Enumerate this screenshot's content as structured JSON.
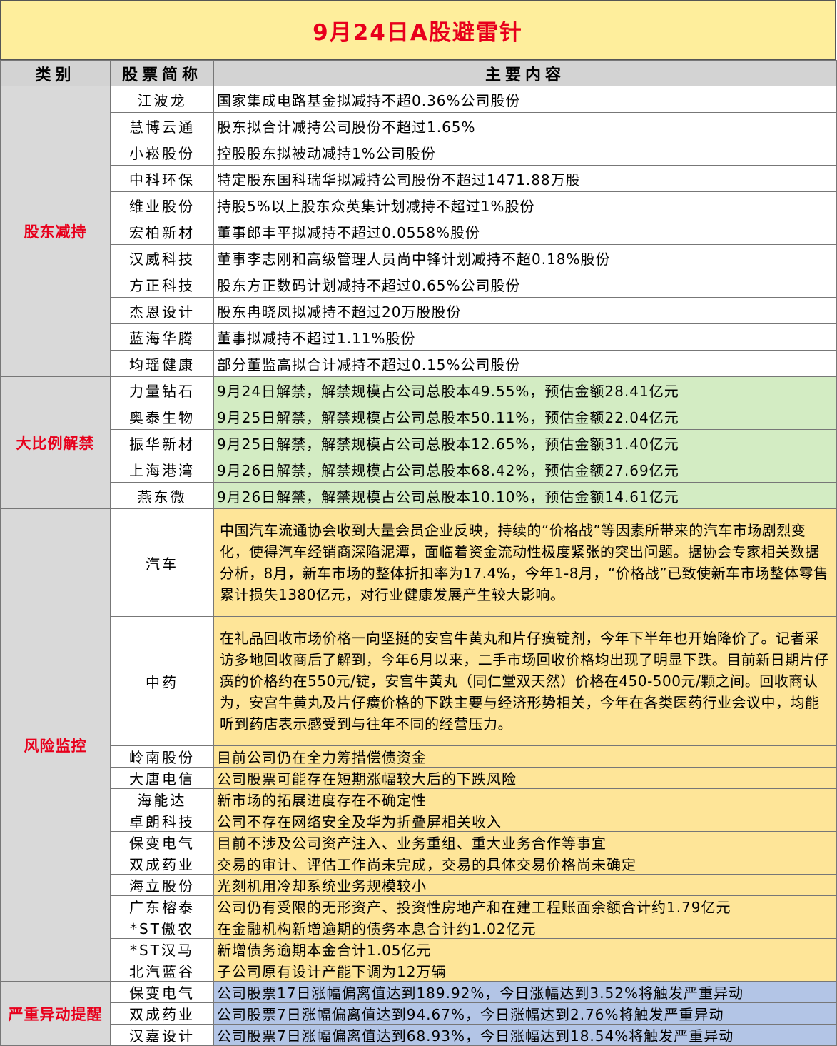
{
  "title": "9月24日A股避雷针",
  "headers": {
    "category": "类别",
    "stock": "股票简称",
    "content": "主要内容"
  },
  "sections": [
    {
      "category": "股东减持",
      "rows": [
        {
          "name": "江波龙",
          "content": "国家集成电路基金拟减持不超0.36%公司股份"
        },
        {
          "name": "慧博云通",
          "content": "股东拟合计减持公司股份不超过1.65%"
        },
        {
          "name": "小崧股份",
          "content": "控股股东拟被动减持1%公司股份"
        },
        {
          "name": "中科环保",
          "content": "特定股东国科瑞华拟减持公司股份不超过1471.88万股"
        },
        {
          "name": "维业股份",
          "content": "持股5%以上股东众英集计划减持不超过1%股份"
        },
        {
          "name": "宏柏新材",
          "content": "董事郎丰平拟减持不超过0.0558%股份"
        },
        {
          "name": "汉威科技",
          "content": "董事李志刚和高级管理人员尚中锋计划减持不超0.18%股份"
        },
        {
          "name": "方正科技",
          "content": "股东方正数码计划减持不超过0.65%公司股份"
        },
        {
          "name": "杰恩设计",
          "content": "股东冉晓凤拟减持不超过20万股股份"
        },
        {
          "name": "蓝海华腾",
          "content": "董事拟减持不超过1.11%股份"
        },
        {
          "name": "均瑶健康",
          "content": "部分董监高拟合计减持不超过0.15%公司股份"
        }
      ]
    },
    {
      "category": "大比例解禁",
      "rows": [
        {
          "name": "力量钻石",
          "content": "9月24日解禁，解禁规模占公司总股本49.55%，预估金额28.41亿元"
        },
        {
          "name": "奥泰生物",
          "content": "9月25日解禁，解禁规模占公司总股本50.11%，预估金额22.04亿元"
        },
        {
          "name": "振华新材",
          "content": "9月25日解禁，解禁规模占公司总股本12.65%，预估金额31.40亿元"
        },
        {
          "name": "上海港湾",
          "content": "9月26日解禁，解禁规模占公司总股本68.42%，预估金额27.69亿元"
        },
        {
          "name": "燕东微",
          "content": "9月26日解禁，解禁规模占公司总股本10.10%，预估金额14.61亿元"
        }
      ]
    },
    {
      "category": "风险监控",
      "long_rows": [
        {
          "name": "汽车",
          "content": "中国汽车流通协会收到大量会员企业反映，持续的“价格战”等因素所带来的汽车市场剧烈变化，使得汽车经销商深陷泥潭，面临着资金流动性极度紧张的突出问题。据协会专家相关数据分析，8月，新车市场的整体折扣率为17.4%，今年1-8月，“价格战”已致使新车市场整体零售累计损失1380亿元，对行业健康发展产生较大影响。"
        },
        {
          "name": "中药",
          "content": "在礼品回收市场价格一向坚挺的安宫牛黄丸和片仔癀锭剂，今年下半年也开始降价了。记者采访多地回收商后了解到，今年6月以来，二手市场回收价格均出现了明显下跌。目前新日期片仔癀的价格约在550元/锭，安宫牛黄丸（同仁堂双天然）价格在450-500元/颗之间。回收商认为，安宫牛黄丸及片仔癀价格的下跌主要与经济形势相关，今年在各类医药行业会议中，均能听到药店表示感受到与往年不同的经营压力。"
        }
      ],
      "rows": [
        {
          "name": "岭南股份",
          "content": "目前公司仍在全力筹措偿债资金"
        },
        {
          "name": "大唐电信",
          "content": "公司股票可能存在短期涨幅较大后的下跌风险"
        },
        {
          "name": "海能达",
          "content": "新市场的拓展进度存在不确定性"
        },
        {
          "name": "卓朗科技",
          "content": "公司不存在网络安全及华为折叠屏相关收入"
        },
        {
          "name": "保变电气",
          "content": "目前不涉及公司资产注入、业务重组、重大业务合作等事宜"
        },
        {
          "name": "双成药业",
          "content": "交易的审计、评估工作尚未完成，交易的具体交易价格尚未确定"
        },
        {
          "name": "海立股份",
          "content": "光刻机用冷却系统业务规模较小"
        },
        {
          "name": "广东榕泰",
          "content": "公司仍有受限的无形资产、投资性房地产和在建工程账面余额合计约1.79亿元"
        },
        {
          "name": "*ST傲农",
          "content": "在金融机构新增逾期的债务本息合计约1.02亿元"
        },
        {
          "name": "*ST汉马",
          "content": "新增债务逾期本金合计1.05亿元"
        },
        {
          "name": "北汽蓝谷",
          "content": "子公司原有设计产能下调为12万辆"
        }
      ]
    },
    {
      "category": "严重异动提醒",
      "rows": [
        {
          "name": "保变电气",
          "content": "公司股票17日涨幅偏离值达到189.92%，今日涨幅达到3.52%将触发严重异动"
        },
        {
          "name": "双成药业",
          "content": "公司股票7日涨幅偏离值达到94.67%，今日涨幅达到2.76%将触发严重异动"
        },
        {
          "name": "汉嘉设计",
          "content": "公司股票7日涨幅偏离值达到68.93%，今日涨幅达到18.54%将触发严重异动"
        }
      ]
    }
  ],
  "colors": {
    "title_bg": "#FEEE9C",
    "title_text": "#E8001C",
    "header_bg": "#D3D3D3",
    "category_bg": "#D9D9D9",
    "category_text": "#E8001C",
    "unlock_bg": "#D3ECC3",
    "risk_bg": "#FEE598",
    "alert_bg": "#B3C5E6"
  }
}
